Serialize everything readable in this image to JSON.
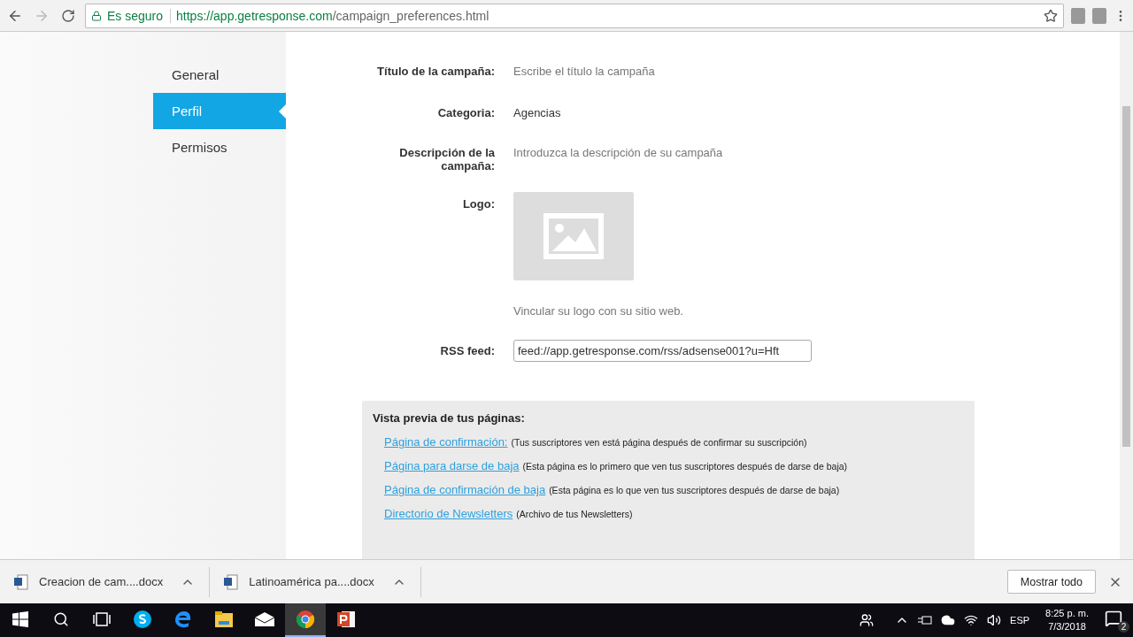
{
  "browser": {
    "security": "Es seguro",
    "url_host": "https://app.getresponse.com",
    "url_path": "/campaign_preferences.html"
  },
  "sidebar": {
    "items": [
      {
        "label": "General",
        "selected": false
      },
      {
        "label": "Perfil",
        "selected": true
      },
      {
        "label": "Permisos",
        "selected": false
      }
    ]
  },
  "form": {
    "fields": [
      {
        "kind": "text",
        "label": "Título de la campaña:",
        "placeholder": "Escribe el título la campaña"
      },
      {
        "kind": "value",
        "label": "Categoria:",
        "value": "Agencias"
      },
      {
        "kind": "text",
        "label": "Descripción de la campaña:",
        "placeholder": "Introduzca la descripción de su campaña"
      },
      {
        "kind": "logo",
        "label": "Logo:",
        "hint": "Vincular su logo con su sitio web."
      },
      {
        "kind": "input",
        "label": "RSS feed:",
        "value": "feed://app.getresponse.com/rss/adsense001?u=Hft"
      }
    ]
  },
  "preview": {
    "title": "Vista previa de tus páginas:",
    "links": [
      {
        "link": "Página de confirmación:",
        "note": "(Tus suscriptores ven está página después de confirmar su suscripción)"
      },
      {
        "link": "Página para darse de baja",
        "note": "(Esta página es lo primero que ven tus suscriptores después de darse de baja)"
      },
      {
        "link": "Página de confirmación de baja",
        "note": "(Esta página es lo que ven tus suscriptores después de darse de baja)"
      },
      {
        "link": "Directorio de Newsletters",
        "note": "(Archivo de tus Newsletters)"
      }
    ]
  },
  "downloads": {
    "files": [
      {
        "name": "Creacion de cam....docx"
      },
      {
        "name": "Latinoamérica pa....docx"
      }
    ],
    "show_all": "Mostrar todo"
  },
  "taskbar": {
    "apps": [
      {
        "kind": "skype",
        "active": false
      },
      {
        "kind": "edge",
        "active": false
      },
      {
        "kind": "explorer",
        "active": false
      },
      {
        "kind": "mail",
        "active": false
      },
      {
        "kind": "chrome",
        "active": true
      },
      {
        "kind": "powerpoint",
        "active": false
      }
    ],
    "language": "ESP",
    "time": "8:25 p. m.",
    "date": "7/3/2018",
    "notifications": "2"
  }
}
